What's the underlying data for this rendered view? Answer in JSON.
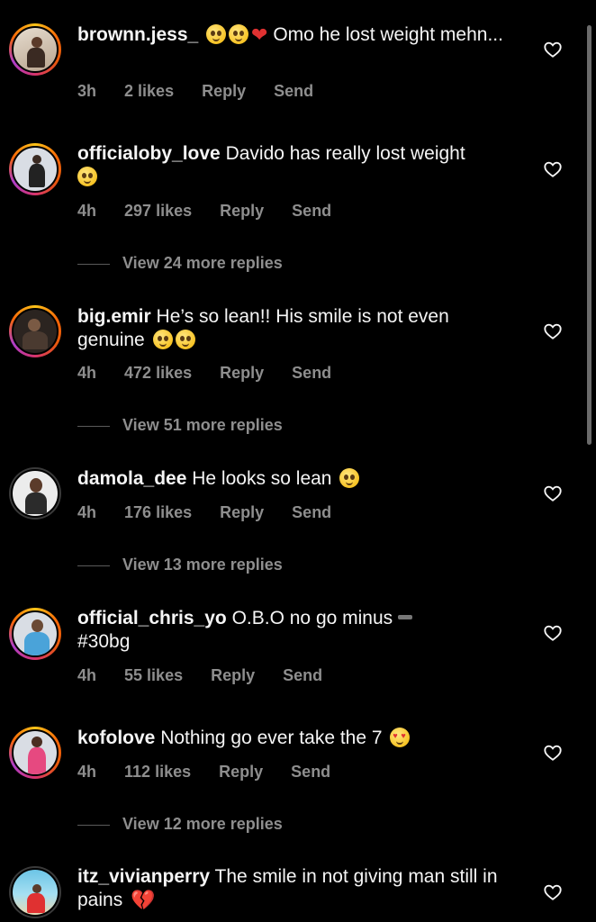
{
  "comments": [
    {
      "username": "brownn.jess_",
      "text": "Omo he lost weight mehn...",
      "emojis_before_text": [
        "pleading-face",
        "pleading-face",
        "red-heart"
      ],
      "time": "3h",
      "likes": "2 likes",
      "reply": "Reply",
      "send": "Send",
      "view_more": ""
    },
    {
      "username": "officialoby_love",
      "text": "Davido has really lost weight",
      "emojis_after_text": [
        "crying-face"
      ],
      "time": "4h",
      "likes": "297 likes",
      "reply": "Reply",
      "send": "Send",
      "view_more": "View 24 more replies"
    },
    {
      "username": "big.emir",
      "text": "He’s so lean!! His smile is not even genuine",
      "emojis_after_text": [
        "smiling-face-with-tear",
        "crying-face"
      ],
      "time": "4h",
      "likes": "472 likes",
      "reply": "Reply",
      "send": "Send",
      "view_more": "View 51 more replies"
    },
    {
      "username": "damola_dee",
      "text": "He looks so lean",
      "emojis_after_text": [
        "pleading-face"
      ],
      "time": "4h",
      "likes": "176 likes",
      "reply": "Reply",
      "send": "Send",
      "view_more": "View 13 more replies"
    },
    {
      "username": "official_chris_yo",
      "text": "O.B.O no go minus",
      "text_line2": "#30bg",
      "time": "4h",
      "likes": "55 likes",
      "reply": "Reply",
      "send": "Send",
      "view_more": ""
    },
    {
      "username": "kofolove",
      "text": "Nothing go ever take the 7",
      "emojis_after_text": [
        "smiling-face-with-heart-eyes"
      ],
      "time": "4h",
      "likes": "112 likes",
      "reply": "Reply",
      "send": "Send",
      "view_more": "View 12 more replies"
    },
    {
      "username": "itz_vivianperry",
      "text": "The smile in not giving man still in pains",
      "emojis_after_text": [
        "broken-heart"
      ],
      "time": "",
      "likes": "",
      "reply": "",
      "send": "",
      "view_more": ""
    }
  ],
  "icons": {
    "like": "heart-outline-icon"
  },
  "colors": {
    "background": "#000000",
    "text": "#f5f5f5",
    "meta": "#8e8e8e",
    "story_ring": "#f76707"
  }
}
